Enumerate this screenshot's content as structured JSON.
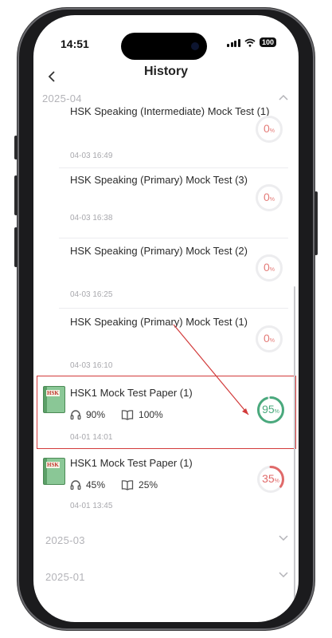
{
  "status_bar": {
    "time": "14:51",
    "battery": "100"
  },
  "header": {
    "title": "History"
  },
  "months": [
    {
      "label": "2025-04",
      "expanded": true
    },
    {
      "label": "2025-03",
      "expanded": false
    },
    {
      "label": "2025-01",
      "expanded": false
    }
  ],
  "items": [
    {
      "title": "HSK Speaking (Intermediate) Mock Test (1)",
      "time": "04-03 16:49",
      "score": "0",
      "score_color": "#e47b78"
    },
    {
      "title": "HSK Speaking (Primary) Mock Test (3)",
      "time": "04-03 16:38",
      "score": "0",
      "score_color": "#e47b78"
    },
    {
      "title": "HSK Speaking (Primary) Mock Test (2)",
      "time": "04-03 16:25",
      "score": "0",
      "score_color": "#e47b78"
    },
    {
      "title": "HSK Speaking (Primary) Mock Test (1)",
      "time": "04-03 16:10",
      "score": "0",
      "score_color": "#e47b78"
    },
    {
      "title": "HSK1 Mock Test Paper (1)",
      "time": "04-01 14:01",
      "score": "95",
      "score_color": "#4aa97d",
      "listening": "90%",
      "reading": "100%",
      "book_label": "HSK"
    },
    {
      "title": "HSK1 Mock Test Paper (1)",
      "time": "04-01 13:45",
      "score": "35",
      "score_color": "#e06a6a",
      "listening": "45%",
      "reading": "25%",
      "book_label": "HSK"
    }
  ],
  "score_unit": "%",
  "colors": {
    "accent_green": "#4aa97d",
    "accent_red": "#e06a6a",
    "highlight": "#d23a3a"
  }
}
